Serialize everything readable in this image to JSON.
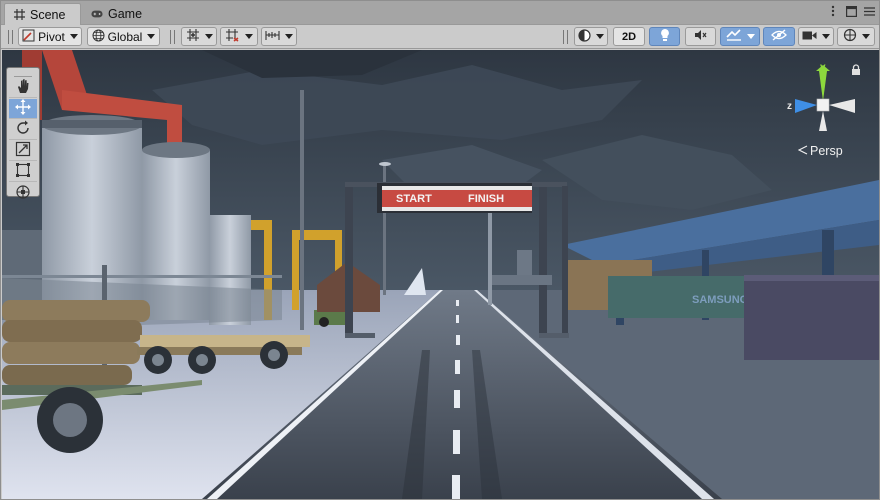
{
  "tabs": [
    {
      "label": "Scene",
      "icon": "grid-icon",
      "active": true
    },
    {
      "label": "Game",
      "icon": "gamepad-icon",
      "active": false
    }
  ],
  "window_controls": [
    "more-icon",
    "maximize-icon",
    "menu-icon"
  ],
  "toolbar": {
    "pivot_label": "Pivot",
    "global_label": "Global",
    "mode_2d_label": "2D"
  },
  "tools": [
    "hand-tool",
    "move-tool",
    "rotate-tool",
    "scale-tool",
    "rect-tool",
    "transform-tool"
  ],
  "active_tool": "move-tool",
  "scene": {
    "sign_start": "START",
    "sign_finish": "FINISH",
    "container_logo": "SAMSUNG"
  },
  "gizmo": {
    "y_label": "y",
    "z_label": "z",
    "projection_label": "Persp"
  },
  "colors": {
    "accent_blue": "#7da5d8",
    "gizmo_x": "#e8e8e8",
    "gizmo_y": "#8dd83d",
    "gizmo_z": "#3f8fe6",
    "sky": "#3b4654"
  }
}
